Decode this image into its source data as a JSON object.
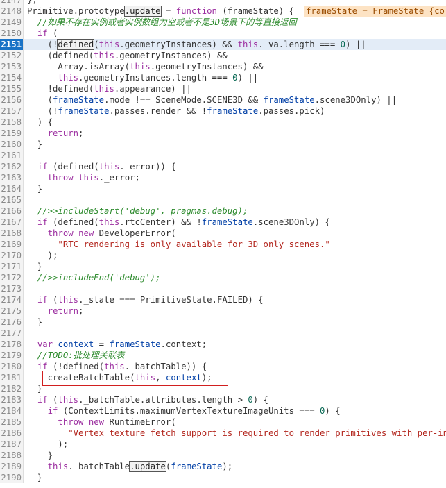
{
  "editor": {
    "current_line": "2151",
    "hint_text": "frameState = FrameState {co",
    "lines": [
      {
        "num": "2147",
        "tokens": [
          {
            "t": "};",
            "c": "fn"
          }
        ]
      },
      {
        "num": "2148",
        "tokens": [
          {
            "t": "Primitive.prototype",
            "c": "fn"
          },
          {
            "t": ".update",
            "c": "box"
          },
          {
            "t": " = ",
            "c": "fn"
          },
          {
            "t": "function",
            "c": "kw"
          },
          {
            "t": " (frameState) {",
            "c": "fn"
          }
        ]
      },
      {
        "num": "2149",
        "tokens": [
          {
            "t": "  //如果不存在实例或者实例数组为空或者不是3D场景下的等直接返回",
            "c": "com"
          }
        ]
      },
      {
        "num": "2150",
        "tokens": [
          {
            "t": "  ",
            "c": "fn"
          },
          {
            "t": "if",
            "c": "kw"
          },
          {
            "t": " (",
            "c": "fn"
          }
        ]
      },
      {
        "num": "2151",
        "tokens": [
          {
            "t": "    (!",
            "c": "fn"
          },
          {
            "t": "defined",
            "c": "box"
          },
          {
            "t": "(",
            "c": "fn"
          },
          {
            "t": "this",
            "c": "kw"
          },
          {
            "t": ".geometryInstances) && ",
            "c": "fn"
          },
          {
            "t": "this",
            "c": "kw"
          },
          {
            "t": "._va.length === ",
            "c": "fn"
          },
          {
            "t": "0",
            "c": "num"
          },
          {
            "t": ") ||",
            "c": "fn"
          }
        ]
      },
      {
        "num": "2152",
        "tokens": [
          {
            "t": "    (defined(",
            "c": "fn"
          },
          {
            "t": "this",
            "c": "kw"
          },
          {
            "t": ".geometryInstances) &&",
            "c": "fn"
          }
        ]
      },
      {
        "num": "2153",
        "tokens": [
          {
            "t": "      Array.isArray(",
            "c": "fn"
          },
          {
            "t": "this",
            "c": "kw"
          },
          {
            "t": ".geometryInstances) &&",
            "c": "fn"
          }
        ]
      },
      {
        "num": "2154",
        "tokens": [
          {
            "t": "      ",
            "c": "fn"
          },
          {
            "t": "this",
            "c": "kw"
          },
          {
            "t": ".geometryInstances.length === ",
            "c": "fn"
          },
          {
            "t": "0",
            "c": "num"
          },
          {
            "t": ") ||",
            "c": "fn"
          }
        ]
      },
      {
        "num": "2155",
        "tokens": [
          {
            "t": "    !defined(",
            "c": "fn"
          },
          {
            "t": "this",
            "c": "kw"
          },
          {
            "t": ".appearance) ||",
            "c": "fn"
          }
        ]
      },
      {
        "num": "2156",
        "tokens": [
          {
            "t": "    (",
            "c": "fn"
          },
          {
            "t": "frameState",
            "c": "var"
          },
          {
            "t": ".mode !== SceneMode.SCENE3D && ",
            "c": "fn"
          },
          {
            "t": "frameState",
            "c": "var"
          },
          {
            "t": ".scene3DOnly) ||",
            "c": "fn"
          }
        ]
      },
      {
        "num": "2157",
        "tokens": [
          {
            "t": "    (!",
            "c": "fn"
          },
          {
            "t": "frameState",
            "c": "var"
          },
          {
            "t": ".passes.render && !",
            "c": "fn"
          },
          {
            "t": "frameState",
            "c": "var"
          },
          {
            "t": ".passes.pick)",
            "c": "fn"
          }
        ]
      },
      {
        "num": "2158",
        "tokens": [
          {
            "t": "  ) {",
            "c": "fn"
          }
        ]
      },
      {
        "num": "2159",
        "tokens": [
          {
            "t": "    ",
            "c": "fn"
          },
          {
            "t": "return",
            "c": "kw"
          },
          {
            "t": ";",
            "c": "fn"
          }
        ]
      },
      {
        "num": "2160",
        "tokens": [
          {
            "t": "  }",
            "c": "fn"
          }
        ]
      },
      {
        "num": "2161",
        "tokens": [
          {
            "t": "",
            "c": "fn"
          }
        ]
      },
      {
        "num": "2162",
        "tokens": [
          {
            "t": "  ",
            "c": "fn"
          },
          {
            "t": "if",
            "c": "kw"
          },
          {
            "t": " (defined(",
            "c": "fn"
          },
          {
            "t": "this",
            "c": "kw"
          },
          {
            "t": "._error)) {",
            "c": "fn"
          }
        ]
      },
      {
        "num": "2163",
        "tokens": [
          {
            "t": "    ",
            "c": "fn"
          },
          {
            "t": "throw",
            "c": "kw"
          },
          {
            "t": " ",
            "c": "fn"
          },
          {
            "t": "this",
            "c": "kw"
          },
          {
            "t": "._error;",
            "c": "fn"
          }
        ]
      },
      {
        "num": "2164",
        "tokens": [
          {
            "t": "  }",
            "c": "fn"
          }
        ]
      },
      {
        "num": "2165",
        "tokens": [
          {
            "t": "",
            "c": "fn"
          }
        ]
      },
      {
        "num": "2166",
        "tokens": [
          {
            "t": "  //>>includeStart('debug', pragmas.debug);",
            "c": "com"
          }
        ]
      },
      {
        "num": "2167",
        "tokens": [
          {
            "t": "  ",
            "c": "fn"
          },
          {
            "t": "if",
            "c": "kw"
          },
          {
            "t": " (defined(",
            "c": "fn"
          },
          {
            "t": "this",
            "c": "kw"
          },
          {
            "t": ".rtcCenter) && !",
            "c": "fn"
          },
          {
            "t": "frameState",
            "c": "var"
          },
          {
            "t": ".scene3DOnly) {",
            "c": "fn"
          }
        ]
      },
      {
        "num": "2168",
        "tokens": [
          {
            "t": "    ",
            "c": "fn"
          },
          {
            "t": "throw",
            "c": "kw"
          },
          {
            "t": " ",
            "c": "fn"
          },
          {
            "t": "new",
            "c": "kw"
          },
          {
            "t": " DeveloperError(",
            "c": "fn"
          }
        ]
      },
      {
        "num": "2169",
        "tokens": [
          {
            "t": "      ",
            "c": "fn"
          },
          {
            "t": "\"RTC rendering is only available for 3D only scenes.\"",
            "c": "str"
          }
        ]
      },
      {
        "num": "2170",
        "tokens": [
          {
            "t": "    );",
            "c": "fn"
          }
        ]
      },
      {
        "num": "2171",
        "tokens": [
          {
            "t": "  }",
            "c": "fn"
          }
        ]
      },
      {
        "num": "2172",
        "tokens": [
          {
            "t": "  //>>includeEnd('debug');",
            "c": "com"
          }
        ]
      },
      {
        "num": "2173",
        "tokens": [
          {
            "t": "",
            "c": "fn"
          }
        ]
      },
      {
        "num": "2174",
        "tokens": [
          {
            "t": "  ",
            "c": "fn"
          },
          {
            "t": "if",
            "c": "kw"
          },
          {
            "t": " (",
            "c": "fn"
          },
          {
            "t": "this",
            "c": "kw"
          },
          {
            "t": "._state === PrimitiveState.FAILED) {",
            "c": "fn"
          }
        ]
      },
      {
        "num": "2175",
        "tokens": [
          {
            "t": "    ",
            "c": "fn"
          },
          {
            "t": "return",
            "c": "kw"
          },
          {
            "t": ";",
            "c": "fn"
          }
        ]
      },
      {
        "num": "2176",
        "tokens": [
          {
            "t": "  }",
            "c": "fn"
          }
        ]
      },
      {
        "num": "2177",
        "tokens": [
          {
            "t": "",
            "c": "fn"
          }
        ]
      },
      {
        "num": "2178",
        "tokens": [
          {
            "t": "  ",
            "c": "fn"
          },
          {
            "t": "var",
            "c": "kw"
          },
          {
            "t": " ",
            "c": "fn"
          },
          {
            "t": "context",
            "c": "var"
          },
          {
            "t": " = ",
            "c": "fn"
          },
          {
            "t": "frameState",
            "c": "var"
          },
          {
            "t": ".context;",
            "c": "fn"
          }
        ]
      },
      {
        "num": "2179",
        "tokens": [
          {
            "t": "  //TODO:批处理关联表",
            "c": "com"
          }
        ]
      },
      {
        "num": "2180",
        "tokens": [
          {
            "t": "  ",
            "c": "fn"
          },
          {
            "t": "if",
            "c": "kw"
          },
          {
            "t": " (!defined(",
            "c": "fn"
          },
          {
            "t": "this",
            "c": "kw"
          },
          {
            "t": "._batchTable)) {",
            "c": "fn"
          }
        ]
      },
      {
        "num": "2181",
        "tokens": [
          {
            "t": "    createBatchTable(",
            "c": "fn"
          },
          {
            "t": "this",
            "c": "kw"
          },
          {
            "t": ", ",
            "c": "fn"
          },
          {
            "t": "context",
            "c": "var"
          },
          {
            "t": ");",
            "c": "fn"
          }
        ]
      },
      {
        "num": "2182",
        "tokens": [
          {
            "t": "  }",
            "c": "fn"
          }
        ]
      },
      {
        "num": "2183",
        "tokens": [
          {
            "t": "  ",
            "c": "fn"
          },
          {
            "t": "if",
            "c": "kw"
          },
          {
            "t": " (",
            "c": "fn"
          },
          {
            "t": "this",
            "c": "kw"
          },
          {
            "t": "._batchTable.attributes.length > ",
            "c": "fn"
          },
          {
            "t": "0",
            "c": "num"
          },
          {
            "t": ") {",
            "c": "fn"
          }
        ]
      },
      {
        "num": "2184",
        "tokens": [
          {
            "t": "    ",
            "c": "fn"
          },
          {
            "t": "if",
            "c": "kw"
          },
          {
            "t": " (ContextLimits.maximumVertexTextureImageUnits === ",
            "c": "fn"
          },
          {
            "t": "0",
            "c": "num"
          },
          {
            "t": ") {",
            "c": "fn"
          }
        ]
      },
      {
        "num": "2185",
        "tokens": [
          {
            "t": "      ",
            "c": "fn"
          },
          {
            "t": "throw",
            "c": "kw"
          },
          {
            "t": " ",
            "c": "fn"
          },
          {
            "t": "new",
            "c": "kw"
          },
          {
            "t": " RuntimeError(",
            "c": "fn"
          }
        ]
      },
      {
        "num": "2186",
        "tokens": [
          {
            "t": "        ",
            "c": "fn"
          },
          {
            "t": "\"Vertex texture fetch support is required to render primitives with per-in",
            "c": "str"
          }
        ]
      },
      {
        "num": "2187",
        "tokens": [
          {
            "t": "      );",
            "c": "fn"
          }
        ]
      },
      {
        "num": "2188",
        "tokens": [
          {
            "t": "    }",
            "c": "fn"
          }
        ]
      },
      {
        "num": "2189",
        "tokens": [
          {
            "t": "    ",
            "c": "fn"
          },
          {
            "t": "this",
            "c": "kw"
          },
          {
            "t": "._batchTable",
            "c": "fn"
          },
          {
            "t": ".update",
            "c": "box"
          },
          {
            "t": "(",
            "c": "fn"
          },
          {
            "t": "frameState",
            "c": "var"
          },
          {
            "t": ");",
            "c": "fn"
          }
        ]
      },
      {
        "num": "2190",
        "tokens": [
          {
            "t": "  }",
            "c": "fn"
          }
        ]
      }
    ]
  }
}
